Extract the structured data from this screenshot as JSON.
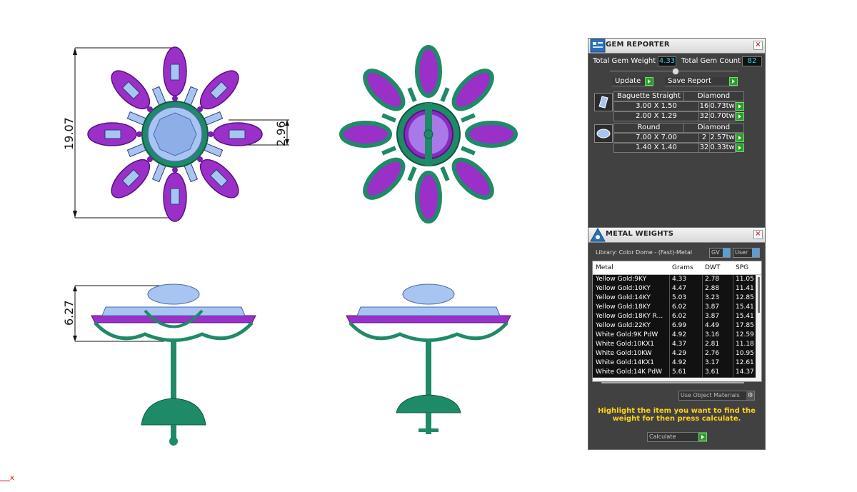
{
  "dimensions": {
    "height_top": "19.07",
    "center_width": "2.96",
    "side_height": "6.27"
  },
  "gem_reporter": {
    "title": "GEM REPORTER",
    "total_weight_label": "Total Gem Weight",
    "total_weight_value": "4.33",
    "total_count_label": "Total Gem Count",
    "total_count_value": "82",
    "update_label": "Update",
    "save_report_label": "Save Report",
    "groups": [
      {
        "shape": "Baguette Straight",
        "material": "Diamond",
        "rows": [
          {
            "size": "3.00 X 1.50",
            "count": "16",
            "weight": "0.73tw"
          },
          {
            "size": "2.00 X 1.29",
            "count": "32",
            "weight": "0.70tw"
          }
        ]
      },
      {
        "shape": "Round",
        "material": "Diamond",
        "rows": [
          {
            "size": "7.00 X 7.00",
            "count": "2",
            "weight": "2.57tw"
          },
          {
            "size": "1.40 X 1.40",
            "count": "32",
            "weight": "0.33tw"
          }
        ]
      }
    ]
  },
  "metal_weights": {
    "title": "METAL WEIGHTS",
    "library": "Library: Color Dome - (Fast)-Metal",
    "gv_label": "GV",
    "user_label": "User",
    "columns": [
      "Metal",
      "Grams",
      "DWT",
      "SPG"
    ],
    "rows": [
      {
        "metal": "Yellow Gold:9KY",
        "grams": "4.33",
        "dwt": "2.78",
        "spg": "11.05"
      },
      {
        "metal": "Yellow Gold:10KY",
        "grams": "4.47",
        "dwt": "2.88",
        "spg": "11.41"
      },
      {
        "metal": "Yellow Gold:14KY",
        "grams": "5.03",
        "dwt": "3.23",
        "spg": "12.85"
      },
      {
        "metal": "Yellow Gold:18KY",
        "grams": "6.02",
        "dwt": "3.87",
        "spg": "15.41"
      },
      {
        "metal": "Yellow Gold:18KY R...",
        "grams": "6.02",
        "dwt": "3.87",
        "spg": "15.41"
      },
      {
        "metal": "Yellow Gold:22KY",
        "grams": "6.99",
        "dwt": "4.49",
        "spg": "17.85"
      },
      {
        "metal": "White Gold:9K PdW",
        "grams": "4.92",
        "dwt": "3.16",
        "spg": "12.59"
      },
      {
        "metal": "White Gold:10KX1",
        "grams": "4.37",
        "dwt": "2.81",
        "spg": "11.18"
      },
      {
        "metal": "White Gold:10KW",
        "grams": "4.29",
        "dwt": "2.76",
        "spg": "10.95"
      },
      {
        "metal": "White Gold:14KX1",
        "grams": "4.92",
        "dwt": "3.17",
        "spg": "12.61"
      },
      {
        "metal": "White Gold:14K PdW",
        "grams": "5.61",
        "dwt": "3.61",
        "spg": "14.37"
      }
    ],
    "use_object_materials": "Use Object Materials",
    "hint": "Highlight the item you want to find the weight for then press calculate.",
    "calculate_label": "Calculate"
  },
  "colors": {
    "metal_purple": "#8a2bbf",
    "metal_green": "#1f8a68",
    "gem_blue": "#a8c4f0",
    "hint_yellow": "#ffd21a",
    "value_cyan": "#39d0e8"
  },
  "origin_mark": "x"
}
